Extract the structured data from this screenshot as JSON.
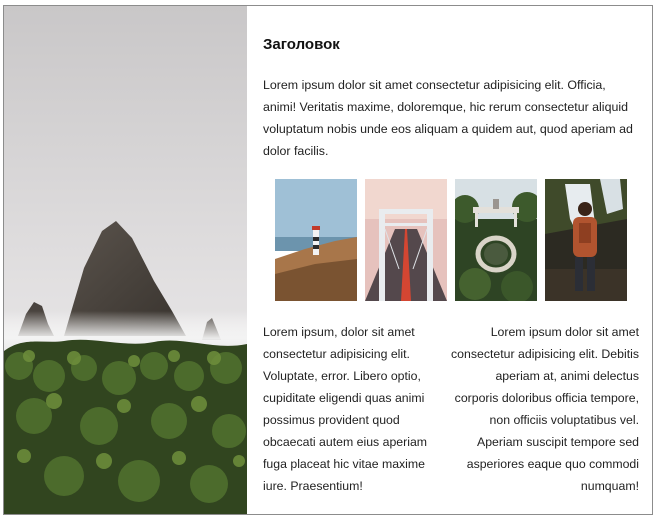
{
  "article": {
    "heading": "Заголовок",
    "lead": "Lorem ipsum dolor sit amet consectetur adipisicing elit. Officia, animi! Veritatis maxime, doloremque, hic rerum consectetur aliquid voluptatum nobis unde eos aliquam a quidem aut, quod aperiam ad dolor facilis.",
    "column_left": "Lorem ipsum, dolor sit amet consectetur adipisicing elit. Voluptate, error. Libero optio, cupiditate eligendi quas animi possimus provident quod obcaecati autem eius aperiam fuga placeat hic vitae maxime iure. Praesentium!",
    "column_right": "Lorem ipsum dolor sit amet consectetur adipisicing elit. Debitis aperiam at, animi delectus corporis doloribus officia tempore, non officiis voluptatibus vel. Aperiam suscipit tempore sed asperiores eaque quo commodi numquam!"
  },
  "images": {
    "hero": "sea-stack-coast-photo",
    "gallery": [
      "lighthouse-photo",
      "bridge-photo",
      "garden-arch-photo",
      "hiker-waterfall-photo"
    ]
  }
}
